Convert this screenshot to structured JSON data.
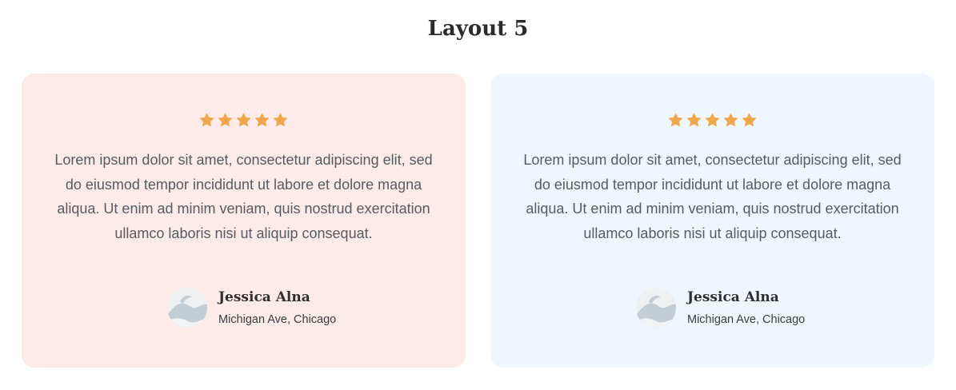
{
  "section": {
    "title": "Layout 5"
  },
  "colors": {
    "card_a_bg": "#fcebe8",
    "card_b_bg": "#f0f6fe",
    "star": "#f0a64a"
  },
  "testimonials": [
    {
      "rating": 5,
      "rating_icon": "star-icon",
      "quote": "Lorem ipsum dolor sit amet, consectetur adipiscing elit, sed do eiusmod tempor incididunt ut labore et dolore magna aliqua. Ut enim ad minim veniam, quis nostrud exercitation ullamco laboris nisi ut aliquip consequat.",
      "avatar_icon": "avatar-placeholder-icon",
      "name": "Jessica Alna",
      "location": "Michigan Ave, Chicago"
    },
    {
      "rating": 5,
      "rating_icon": "star-icon",
      "quote": "Lorem ipsum dolor sit amet, consectetur adipiscing elit, sed do eiusmod tempor incididunt ut labore et dolore magna aliqua. Ut enim ad minim veniam, quis nostrud exercitation ullamco laboris nisi ut aliquip consequat.",
      "avatar_icon": "avatar-placeholder-icon",
      "name": "Jessica Alna",
      "location": "Michigan Ave, Chicago"
    }
  ]
}
